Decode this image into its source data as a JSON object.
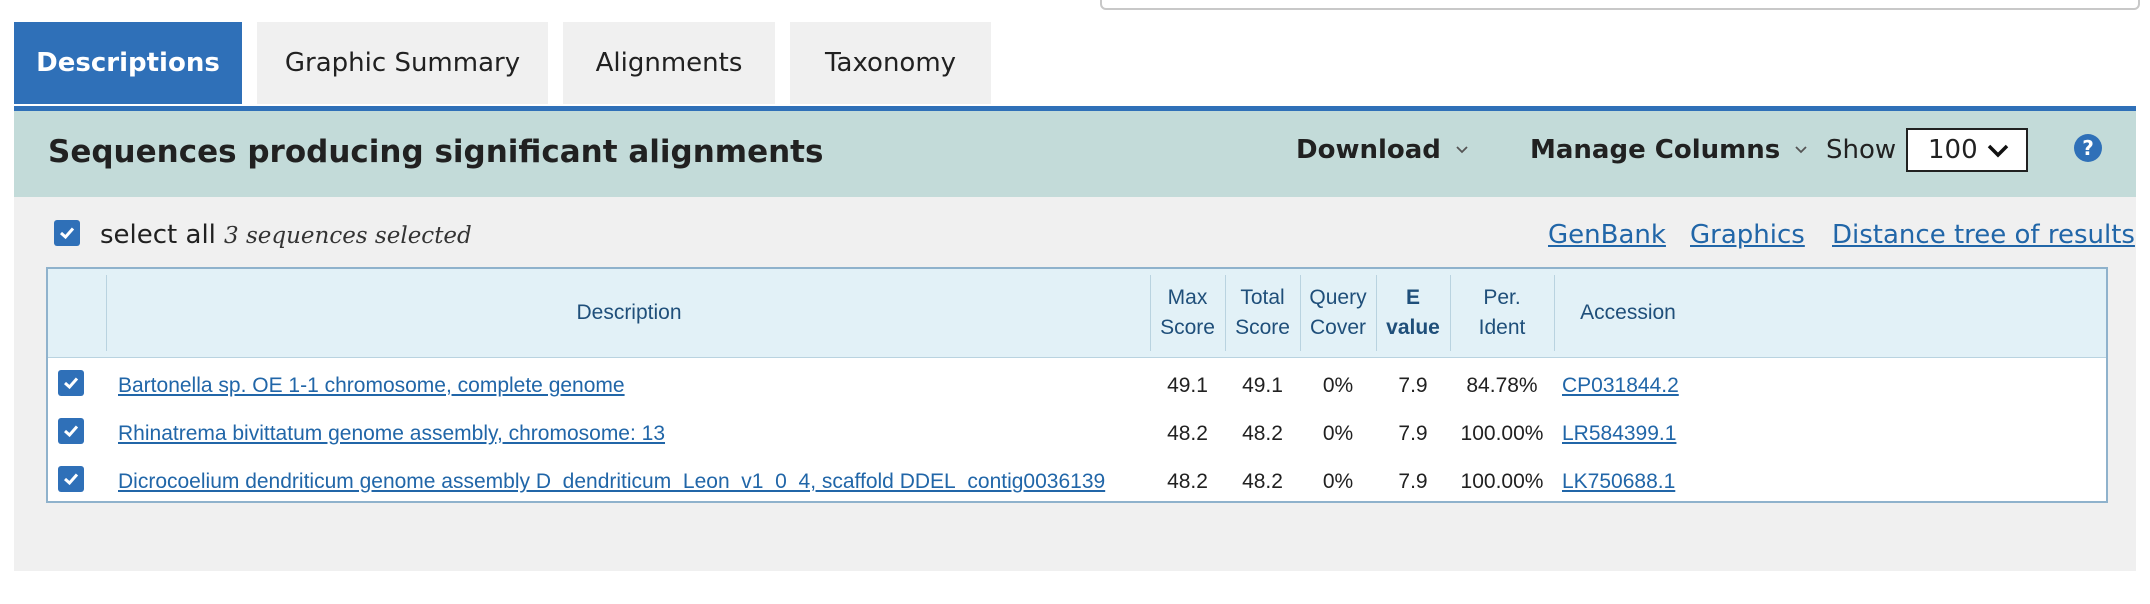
{
  "tabs": [
    {
      "label": "Descriptions",
      "active": true
    },
    {
      "label": "Graphic Summary",
      "active": false
    },
    {
      "label": "Alignments",
      "active": false
    },
    {
      "label": "Taxonomy",
      "active": false
    }
  ],
  "header": {
    "title": "Sequences producing significant alignments",
    "download_label": "Download",
    "manage_columns_label": "Manage Columns",
    "show_label": "Show",
    "show_value": "100",
    "help_glyph": "?"
  },
  "selection": {
    "select_all_label": "select all",
    "selected_count_text": "3 sequences selected",
    "links": [
      "GenBank",
      "Graphics",
      "Distance tree of results"
    ]
  },
  "table": {
    "columns": {
      "description": "Description",
      "max_score": [
        "Max",
        "Score"
      ],
      "total_score": [
        "Total",
        "Score"
      ],
      "query_cover": [
        "Query",
        "Cover"
      ],
      "e_value": [
        "E",
        "value"
      ],
      "per_ident": [
        "Per.",
        "Ident"
      ],
      "accession": "Accession"
    },
    "rows": [
      {
        "checked": true,
        "description": "Bartonella sp. OE 1-1 chromosome, complete genome",
        "max_score": "49.1",
        "total_score": "49.1",
        "query_cover": "0%",
        "e_value": "7.9",
        "per_ident": "84.78%",
        "accession": "CP031844.2"
      },
      {
        "checked": true,
        "description": "Rhinatrema bivittatum genome assembly, chromosome: 13",
        "max_score": "48.2",
        "total_score": "48.2",
        "query_cover": "0%",
        "e_value": "7.9",
        "per_ident": "100.00%",
        "accession": "LR584399.1"
      },
      {
        "checked": true,
        "description": "Dicrocoelium dendriticum genome assembly D_dendriticum_Leon_v1_0_4, scaffold DDEL_contig0036139",
        "max_score": "48.2",
        "total_score": "48.2",
        "query_cover": "0%",
        "e_value": "7.9",
        "per_ident": "100.00%",
        "accession": "LK750688.1"
      }
    ]
  },
  "colors": {
    "accent": "#2f70b8",
    "header_bg": "#c3dbd9",
    "panel_bg": "#f0f0f0",
    "link": "#2166a8"
  }
}
